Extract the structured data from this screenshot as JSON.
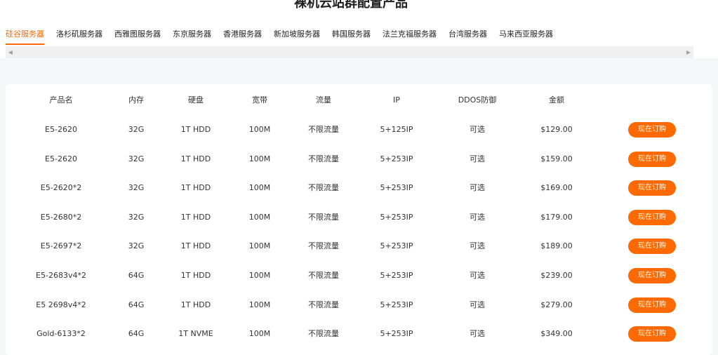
{
  "page_title": "裸机云站群配置产品",
  "tabs": [
    {
      "label": "硅谷服务器",
      "active": true
    },
    {
      "label": "洛杉矶服务器",
      "active": false
    },
    {
      "label": "西雅图服务器",
      "active": false
    },
    {
      "label": "东京服务器",
      "active": false
    },
    {
      "label": "香港服务器",
      "active": false
    },
    {
      "label": "新加坡服务器",
      "active": false
    },
    {
      "label": "韩国服务器",
      "active": false
    },
    {
      "label": "法兰克福服务器",
      "active": false
    },
    {
      "label": "台湾服务器",
      "active": false
    },
    {
      "label": "马来西亚服务器",
      "active": false
    }
  ],
  "scrollbar": {
    "left_arrow": "◀",
    "right_arrow": "▶"
  },
  "colors": {
    "accent": "#ff6a00",
    "panel_bg": "#ffffff",
    "page_bg": "#f6f7f9"
  },
  "table": {
    "headers": [
      "产品名",
      "内存",
      "硬盘",
      "宽带",
      "流量",
      "IP",
      "DDOS防御",
      "金额"
    ],
    "order_label": "现在订购",
    "rows": [
      [
        "E5-2620",
        "32G",
        "1T HDD",
        "100M",
        "不限流量",
        "5+125IP",
        "可选",
        "$129.00"
      ],
      [
        "E5-2620",
        "32G",
        "1T HDD",
        "100M",
        "不限流量",
        "5+253IP",
        "可选",
        "$159.00"
      ],
      [
        "E5-2620*2",
        "32G",
        "1T HDD",
        "100M",
        "不限流量",
        "5+253IP",
        "可选",
        "$169.00"
      ],
      [
        "E5-2680*2",
        "32G",
        "1T HDD",
        "100M",
        "不限流量",
        "5+253IP",
        "可选",
        "$179.00"
      ],
      [
        "E5-2697*2",
        "32G",
        "1T HDD",
        "100M",
        "不限流量",
        "5+253IP",
        "可选",
        "$189.00"
      ],
      [
        "E5-2683v4*2",
        "64G",
        "1T HDD",
        "100M",
        "不限流量",
        "5+253IP",
        "可选",
        "$239.00"
      ],
      [
        "E5 2698v4*2",
        "64G",
        "1T HDD",
        "100M",
        "不限流量",
        "5+253IP",
        "可选",
        "$279.00"
      ],
      [
        "Gold-6133*2",
        "64G",
        "1T NVME",
        "100M",
        "不限流量",
        "5+253IP",
        "可选",
        "$349.00"
      ]
    ]
  }
}
